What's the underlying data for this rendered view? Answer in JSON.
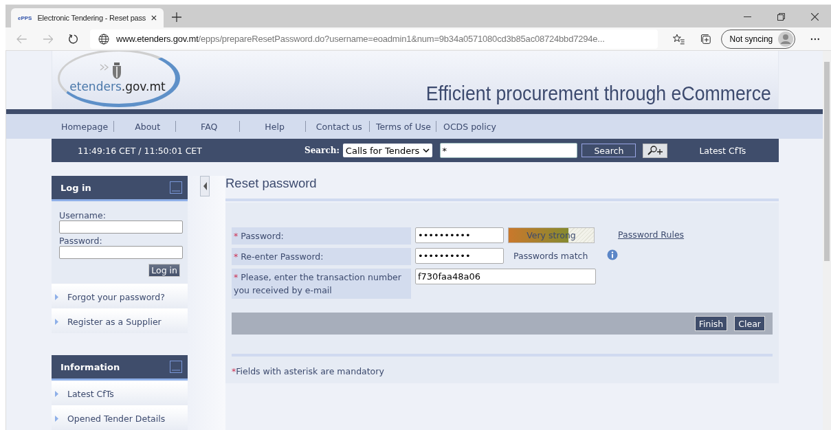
{
  "browser": {
    "tab": {
      "favicon": "ePPS",
      "title": "Electronic Tendering - Reset pass"
    },
    "url_host": "www.etenders.gov.mt",
    "url_path": "/epps/prepareResetPassword.do?username=eoadmin1&num=9b34a0571080cd3b85ac08724bbd7294e...",
    "profile": "Not syncing"
  },
  "header": {
    "logo": {
      "part1": "etenders",
      "part2": ".gov.mt"
    },
    "tagline": "Efficient procurement through eCommerce"
  },
  "nav": [
    "Homepage",
    "About",
    "FAQ",
    "Help",
    "Contact us",
    "Terms of Use",
    "OCDS policy"
  ],
  "search_bar": {
    "time": "11:49:16 CET / 11:50:01 CET",
    "label": "Search:",
    "scope": "Calls for Tenders",
    "query": "*",
    "button": "Search",
    "latest": "Latest CfTs"
  },
  "sidebar": {
    "login": {
      "title": "Log in",
      "username_label": "Username:",
      "password_label": "Password:",
      "button": "Log in",
      "links": [
        "Forgot your password?",
        "Register as a Supplier"
      ]
    },
    "information": {
      "title": "Information",
      "links": [
        "Latest CfTs",
        "Opened Tender Details"
      ]
    }
  },
  "form": {
    "title": "Reset password",
    "fields": [
      {
        "kind": "password",
        "required": "*",
        "label": "Password:",
        "value": "••••••••••",
        "strength": {
          "text": "Very strong",
          "level": 0.7
        },
        "link": "Password Rules"
      },
      {
        "kind": "confirm",
        "required": "*",
        "label": "Re-enter Password:",
        "value": "••••••••••",
        "note": "Passwords match"
      },
      {
        "kind": "text",
        "required": "*",
        "label": "Please, enter the transaction number you received by e-mail",
        "value": "f730faa48a06"
      }
    ],
    "buttons": [
      "Finish",
      "Clear"
    ],
    "footnote_mark": "*",
    "footnote": "Fields with asterisk are mandatory"
  }
}
